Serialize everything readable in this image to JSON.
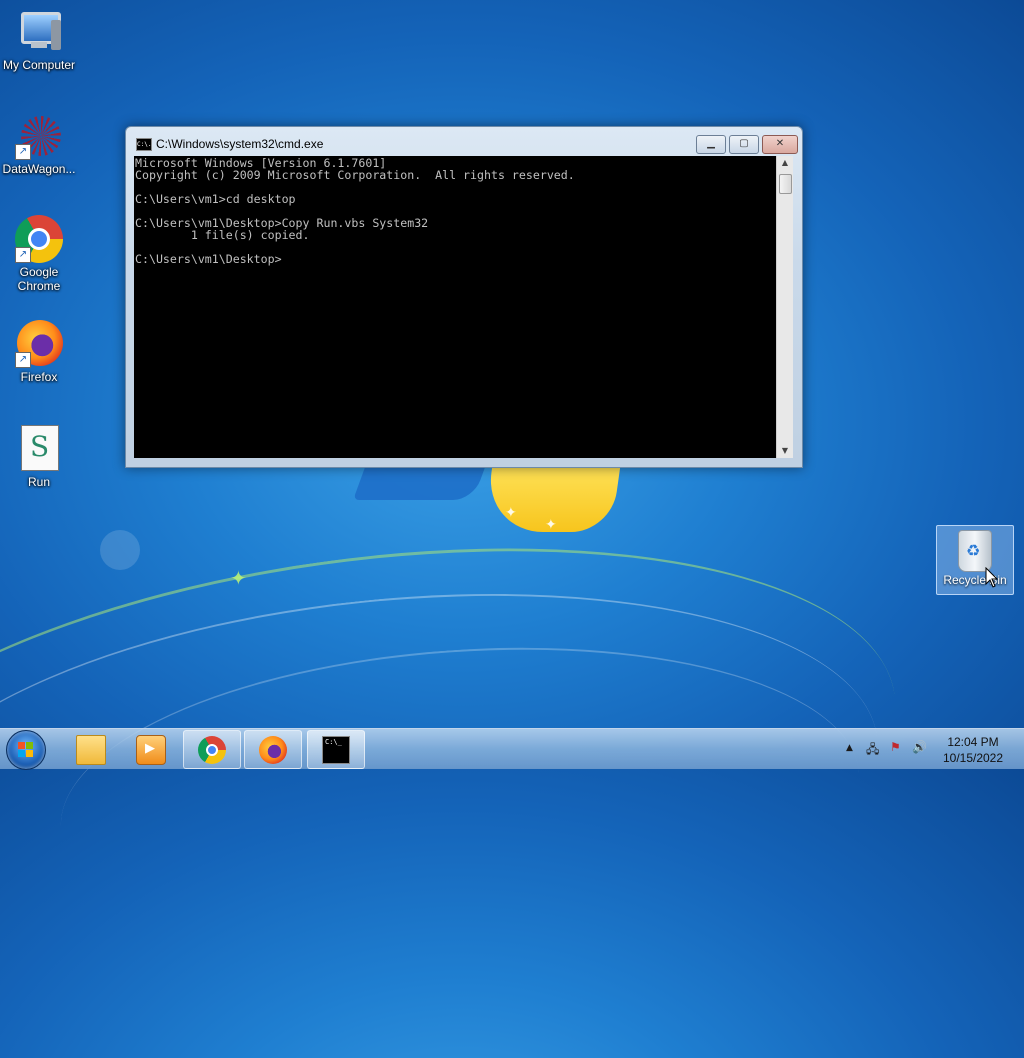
{
  "desktop": {
    "icons": [
      {
        "label": "My Computer"
      },
      {
        "label": "DataWagon..."
      },
      {
        "label": "Google Chrome"
      },
      {
        "label": "Firefox"
      },
      {
        "label": "Run"
      }
    ],
    "recycle_bin": {
      "label": "Recycle Bin"
    }
  },
  "window": {
    "title": "C:\\Windows\\system32\\cmd.exe",
    "title_icon": "C:\\.",
    "console_lines": [
      "Microsoft Windows [Version 6.1.7601]",
      "Copyright (c) 2009 Microsoft Corporation.  All rights reserved.",
      "",
      "C:\\Users\\vm1>cd desktop",
      "",
      "C:\\Users\\vm1\\Desktop>Copy Run.vbs System32",
      "        1 file(s) copied.",
      "",
      "C:\\Users\\vm1\\Desktop>"
    ]
  },
  "taskbar": {
    "items": [
      {
        "name": "windows-explorer",
        "icon": "folder-icon"
      },
      {
        "name": "media-player",
        "icon": "media-player-icon"
      },
      {
        "name": "google-chrome",
        "icon": "chrome-icon"
      },
      {
        "name": "firefox",
        "icon": "firefox-icon"
      },
      {
        "name": "command-prompt",
        "icon": "cmd-icon",
        "icon_text": "C:\\_"
      }
    ],
    "tray_icons": [
      "show-hidden-icons",
      "network-icon",
      "action-center-icon",
      "volume-icon"
    ],
    "tray_glyphs": {
      "arrow": "▲",
      "network": "🖧",
      "flag": "⚑",
      "volume": "🔊"
    },
    "clock": {
      "time": "12:04 PM",
      "date": "10/15/2022"
    }
  },
  "colors": {
    "console_bg": "#000000",
    "console_fg": "#c0c0c0",
    "desktop_accent": "#1f7fd1"
  }
}
